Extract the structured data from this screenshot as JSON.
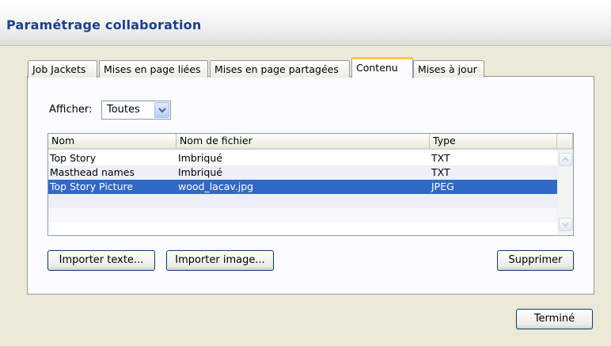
{
  "window": {
    "title": "Paramétrage collaboration"
  },
  "tabs": [
    {
      "label": "Job Jackets",
      "active": false
    },
    {
      "label": "Mises en page liées",
      "active": false
    },
    {
      "label": "Mises en page partagées",
      "active": false
    },
    {
      "label": "Contenu",
      "active": true
    },
    {
      "label": "Mises à jour",
      "active": false
    }
  ],
  "filter": {
    "label": "Afficher:",
    "value": "Toutes"
  },
  "table": {
    "columns": [
      "Nom",
      "Nom de fichier",
      "Type"
    ],
    "rows": [
      {
        "name": "Top Story",
        "file": "Imbriqué",
        "type": "TXT",
        "selected": false
      },
      {
        "name": "Masthead names",
        "file": "Imbriqué",
        "type": "TXT",
        "selected": false
      },
      {
        "name": "Top Story Picture",
        "file": "wood_lacav.jpg",
        "type": "JPEG",
        "selected": true
      }
    ]
  },
  "buttons": {
    "import_text": "Importer texte...",
    "import_image": "Importer image...",
    "delete": "Supprimer",
    "done": "Terminé"
  },
  "colors": {
    "title": "#1a3f8f",
    "tab_active_accent": "#ffc83c",
    "selection": "#3169c6",
    "button_border": "#003c74"
  }
}
